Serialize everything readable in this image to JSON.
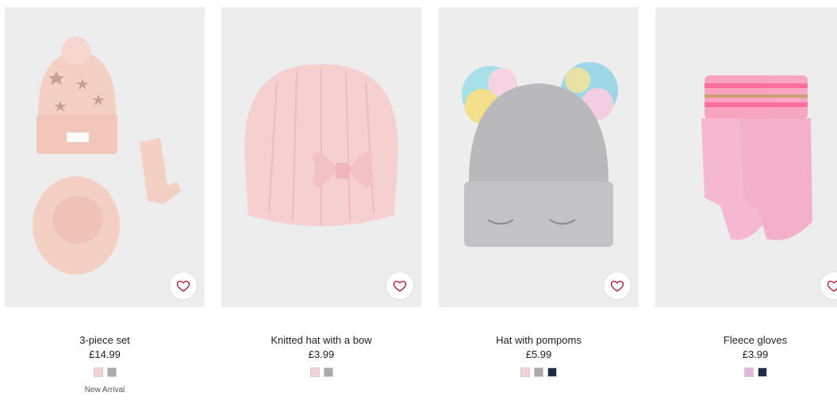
{
  "products": [
    {
      "title": "3-piece set",
      "price": "£14.99",
      "swatches": [
        "#f2d3d8",
        "#a9a9a9"
      ],
      "marker": "New Arrival",
      "favourite_icon": "heart-icon"
    },
    {
      "title": "Knitted hat with a bow",
      "price": "£3.99",
      "swatches": [
        "#f2d3d8",
        "#a9a9a9"
      ],
      "marker": "",
      "favourite_icon": "heart-icon"
    },
    {
      "title": "Hat with pompoms",
      "price": "£5.99",
      "swatches": [
        "#f2d3d8",
        "#a9a9a9",
        "#1f2a44"
      ],
      "marker": "",
      "favourite_icon": "heart-icon"
    },
    {
      "title": "Fleece gloves",
      "price": "£3.99",
      "swatches": [
        "#e6b8d6",
        "#1f2a44"
      ],
      "marker": "",
      "favourite_icon": "heart-icon"
    }
  ],
  "colors": {
    "heart": "#c8102e",
    "text": "#222222"
  }
}
